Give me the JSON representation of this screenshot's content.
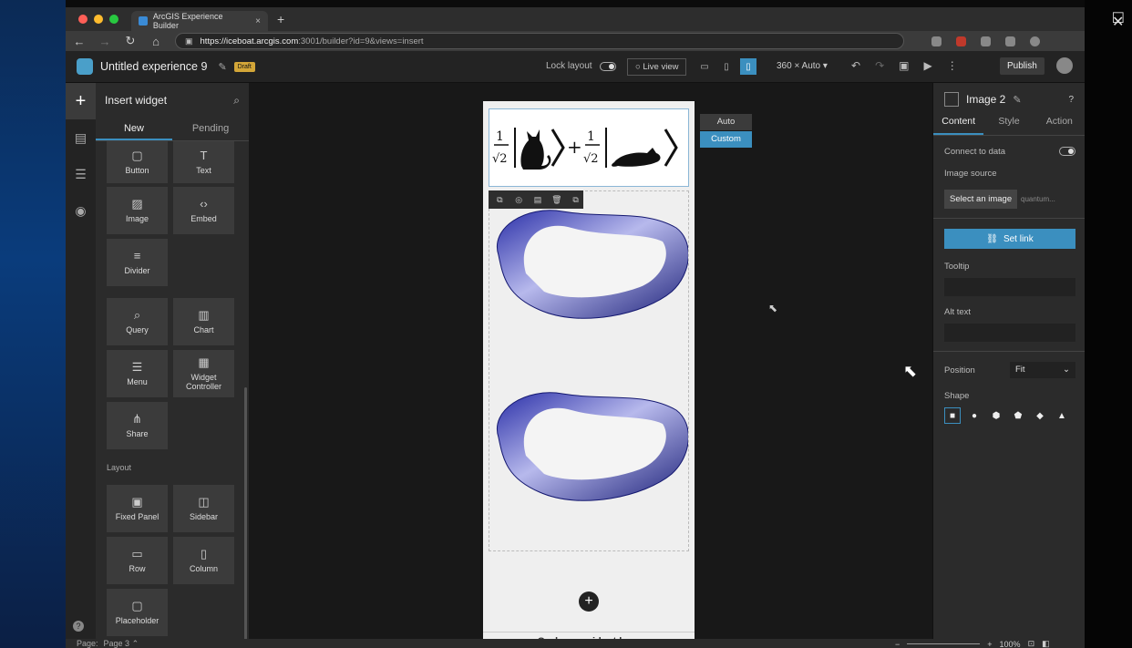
{
  "browser": {
    "tab_title": "ArcGIS Experience Builder",
    "tab_close": "×",
    "new_tab": "+",
    "url_host": "https://iceboat.arcgis.com",
    "url_rest": ":3001/builder?id=9&views=insert",
    "nav": {
      "back": "←",
      "forward": "→",
      "reload": "↻",
      "home": "⌂"
    }
  },
  "window_controls": {
    "minimize": "—",
    "maximize": "☐",
    "close": "✕"
  },
  "header": {
    "title": "Untitled experience 9",
    "draft_badge": "Draft",
    "lock_layout": "Lock layout",
    "live_view": "Live view",
    "size_select": "360 × Auto",
    "publish": "Publish"
  },
  "insert_panel": {
    "title": "Insert widget",
    "tabs": [
      "New",
      "Pending"
    ],
    "widgets": [
      {
        "label": "Button",
        "icon": "button-icon"
      },
      {
        "label": "Text",
        "icon": "text-icon"
      },
      {
        "label": "Image",
        "icon": "image-icon"
      },
      {
        "label": "Embed",
        "icon": "embed-icon"
      },
      {
        "label": "Divider",
        "icon": "divider-icon"
      },
      {
        "label": "Query",
        "icon": "query-icon"
      },
      {
        "label": "Chart",
        "icon": "chart-icon"
      },
      {
        "label": "Menu",
        "icon": "menu-icon"
      },
      {
        "label": "Widget Controller",
        "icon": "widget-controller-icon"
      },
      {
        "label": "Share",
        "icon": "share-icon"
      }
    ],
    "layout_section": "Layout",
    "layout_widgets": [
      {
        "label": "Fixed Panel",
        "icon": "fixed-panel-icon"
      },
      {
        "label": "Sidebar",
        "icon": "sidebar-icon"
      },
      {
        "label": "Row",
        "icon": "row-icon"
      },
      {
        "label": "Column",
        "icon": "column-icon"
      },
      {
        "label": "Placeholder",
        "icon": "placeholder-icon"
      }
    ]
  },
  "canvas": {
    "size_options": [
      "Auto",
      "Custom"
    ],
    "selected_size_option": "Custom",
    "drag_hint": "Or drag a widget here",
    "equation_text": "1/√2 |cat⟩ + 1/√2 |cat⟩"
  },
  "properties": {
    "widget_name": "Image 2",
    "tabs": [
      "Content",
      "Style",
      "Action"
    ],
    "connect_to_data": "Connect to data",
    "image_source": "Image source",
    "select_image": "Select an image",
    "image_file": "quantum...",
    "set_link": "Set link",
    "tooltip": "Tooltip",
    "alt_text": "Alt text",
    "position_label": "Position",
    "position_value": "Fit",
    "shape_label": "Shape"
  },
  "statusbar": {
    "page_label": "Page:",
    "page_value": "Page 3",
    "zoom": "100%"
  },
  "colors": {
    "accent": "#3b8fbf",
    "draft": "#d3a638"
  }
}
